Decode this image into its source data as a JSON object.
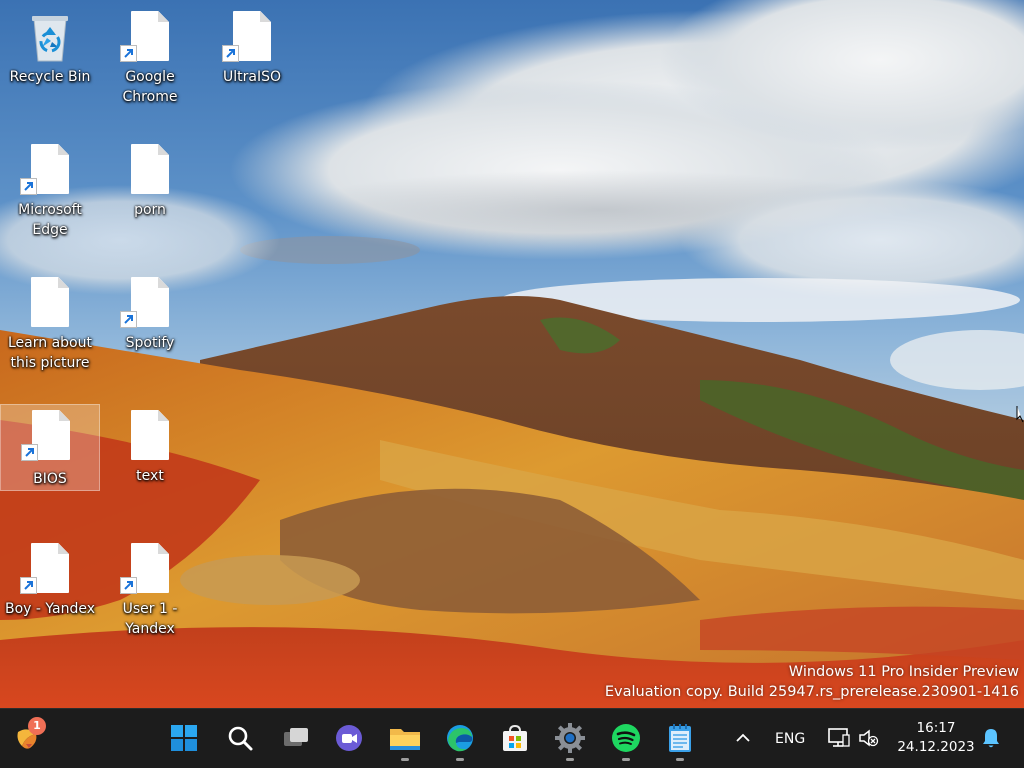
{
  "desktop": {
    "icons": [
      {
        "label": "Recycle Bin"
      },
      {
        "label": "Google Chrome"
      },
      {
        "label": "UltraISO"
      },
      {
        "label": "Microsoft Edge"
      },
      {
        "label": "porn"
      },
      {
        "label": "Learn about this picture"
      },
      {
        "label": "Spotify"
      },
      {
        "label": "BIOS"
      },
      {
        "label": "text"
      },
      {
        "label": "Boy - Yandex"
      },
      {
        "label": "User 1 - Yandex"
      }
    ]
  },
  "watermark": {
    "line1": "Windows 11 Pro Insider Preview",
    "line2": "Evaluation copy. Build 25947.rs_prerelease.230901-1416"
  },
  "taskbar": {
    "widgets_badge": "1",
    "language": "ENG",
    "time": "16:17",
    "date": "24.12.2023",
    "pinned": [
      "start-icon",
      "search-icon",
      "task-view-icon",
      "teams-chat-icon",
      "file-explorer-icon",
      "edge-icon",
      "store-icon",
      "settings-icon",
      "spotify-icon",
      "notepad-icon"
    ]
  },
  "colors": {
    "taskbar_bg": "#1c1c1c",
    "accent_blue": "#0a84ff",
    "spotify_green": "#1ed760"
  }
}
